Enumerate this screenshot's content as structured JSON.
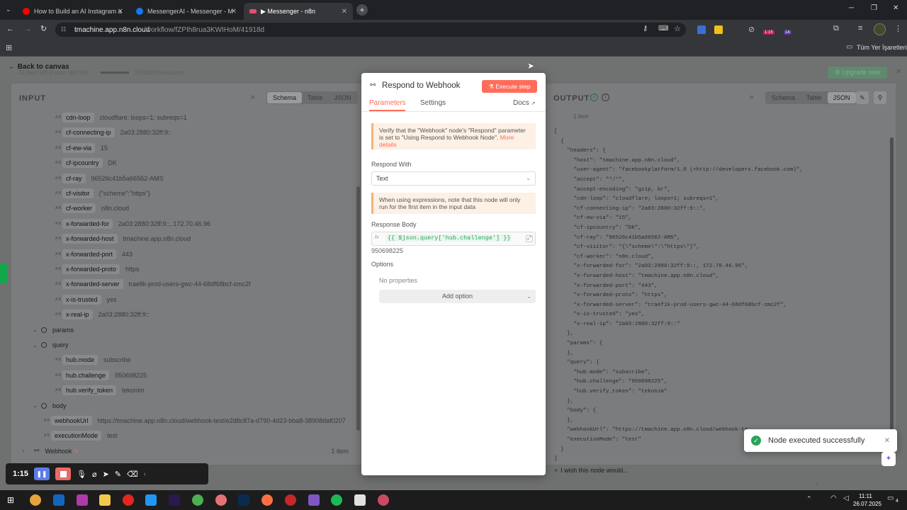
{
  "browser": {
    "tabs": [
      {
        "title": "How to Build an AI Instagram a",
        "color": "#ff0000"
      },
      {
        "title": "MessengerAI - Messenger - M",
        "color": "#1877f2"
      },
      {
        "title": "▶ Messenger - n8n",
        "color": "#ea4b71"
      }
    ],
    "url_host": "tmachine.app.n8n.cloud",
    "url_path": "/workflow/fZPIh8rua3KWIHoM/41918d",
    "bookmarks_label": "Tüm Yer İşaretleri",
    "ext_badge_1": "1:15",
    "ext_badge_2": "14"
  },
  "topstrip": {
    "back_label": "Back to canvas",
    "trial_text": "12 days left in your n8n trial",
    "executions": "37/1000 Executions",
    "upgrade_label": "Upgrade now"
  },
  "input": {
    "title": "INPUT",
    "tabs": [
      "Schema",
      "Table",
      "JSON"
    ],
    "active_tab": "Schema",
    "header_rows": [
      {
        "key": "cdn-loop",
        "value": "cloudflare; loops=1; subreqs=1"
      },
      {
        "key": "cf-connecting-ip",
        "value": "2a03:2880:32ff:9::"
      },
      {
        "key": "cf-ew-via",
        "value": "15"
      },
      {
        "key": "cf-ipcountry",
        "value": "DK"
      },
      {
        "key": "cf-ray",
        "value": "96526c41b5a66562-AMS"
      },
      {
        "key": "cf-visitor",
        "value": "{\"scheme\":\"https\"}"
      },
      {
        "key": "cf-worker",
        "value": "n8n.cloud"
      },
      {
        "key": "x-forwarded-for",
        "value": "2a03:2880:32ff:9::, 172.70.46.96"
      },
      {
        "key": "x-forwarded-host",
        "value": "tmachine.app.n8n.cloud"
      },
      {
        "key": "x-forwarded-port",
        "value": "443"
      },
      {
        "key": "x-forwarded-proto",
        "value": "https"
      },
      {
        "key": "x-forwarded-server",
        "value": "traefik-prod-users-gwc-44-68df68bcf-zmc2f"
      },
      {
        "key": "x-is-trusted",
        "value": "yes"
      },
      {
        "key": "x-real-ip",
        "value": "2a03:2880:32ff:9::"
      }
    ],
    "params_label": "params",
    "query_label": "query",
    "query_rows": [
      {
        "key": "hub.mode",
        "value": "subscribe"
      },
      {
        "key": "hub.challenge",
        "value": "950698225"
      },
      {
        "key": "hub.verify_token",
        "value": "tekonim"
      }
    ],
    "body_label": "body",
    "body_rows": [
      {
        "key": "webhookUrl",
        "value": "https://tmachine.app.n8n.cloud/webhook-test/e2d8c87a-d790-4d23-bba8-38908daf0207"
      },
      {
        "key": "executionMode",
        "value": "test"
      }
    ],
    "node_label": "Webhook",
    "node_count": "1 item"
  },
  "center": {
    "title": "Respond to Webhook",
    "execute_label": "Execute step",
    "tabs": [
      "Parameters",
      "Settings"
    ],
    "docs_label": "Docs",
    "warning_text": "Verify that the \"Webhook\" node's \"Respond\" parameter is set to \"Using Respond to Webhook Node\".",
    "more_details": "More details",
    "respond_with_label": "Respond With",
    "respond_with_value": "Text",
    "expr_note": "When using expressions, note that this node will only run for the first item in the input data",
    "response_body_label": "Response Body",
    "response_body_expr": "{{ $json.query['hub.challenge'] }}",
    "response_body_preview": "950698225",
    "options_label": "Options",
    "no_properties": "No properties",
    "add_option": "Add option",
    "feedback": "I wish this node would..."
  },
  "output": {
    "title": "OUTPUT",
    "items": "1 item",
    "tabs": [
      "Schema",
      "Table",
      "JSON"
    ],
    "active_tab": "JSON",
    "json_lines": [
      "[",
      "  {",
      "    \"headers\": {",
      "      \"host\": \"tmachine.app.n8n.cloud\",",
      "      \"user-agent\": \"facebookplatform/1.0 (+http://developers.facebook.com)\",",
      "      \"accept\": \"*/*\",",
      "      \"accept-encoding\": \"gzip, br\",",
      "      \"cdn-loop\": \"cloudflare; loops=1; subreqs=1\",",
      "      \"cf-connecting-ip\": \"2a03:2880:32ff:9::\",",
      "      \"cf-ew-via\": \"15\",",
      "      \"cf-ipcountry\": \"DK\",",
      "      \"cf-ray\": \"96526c41b5a66562-AMS\",",
      "      \"cf-visitor\": \"{\\\"scheme\\\":\\\"https\\\"}\",",
      "      \"cf-worker\": \"n8n.cloud\",",
      "      \"x-forwarded-for\": \"2a03:2880:32ff:9::, 172.70.46.96\",",
      "      \"x-forwarded-host\": \"tmachine.app.n8n.cloud\",",
      "      \"x-forwarded-port\": \"443\",",
      "      \"x-forwarded-proto\": \"https\",",
      "      \"x-forwarded-server\": \"traefik-prod-users-gwc-44-68df68bcf-zmc2f\",",
      "      \"x-is-trusted\": \"yes\",",
      "      \"x-real-ip\": \"2a03:2880:32ff:9::\"",
      "    },",
      "    \"params\": {",
      "    },",
      "    \"query\": {",
      "      \"hub.mode\": \"subscribe\",",
      "      \"hub.challenge\": \"950698225\",",
      "      \"hub.verify_token\": \"tekonim\"",
      "    },",
      "    \"body\": {",
      "    },",
      "    \"webhookUrl\": \"https://tmachine.app.n8n.cloud/webhook-te",
      "    \"executionMode\": \"test\"",
      "  }",
      "]"
    ]
  },
  "toast": {
    "message": "Node executed successfully"
  },
  "recorder": {
    "time": "1:15"
  },
  "taskbar": {
    "time": "11:11",
    "date": "26.07.2025",
    "notif": "4"
  },
  "colors": {
    "accent": "#ff6d5a",
    "success": "#29a35a",
    "teal": "#11b981"
  }
}
